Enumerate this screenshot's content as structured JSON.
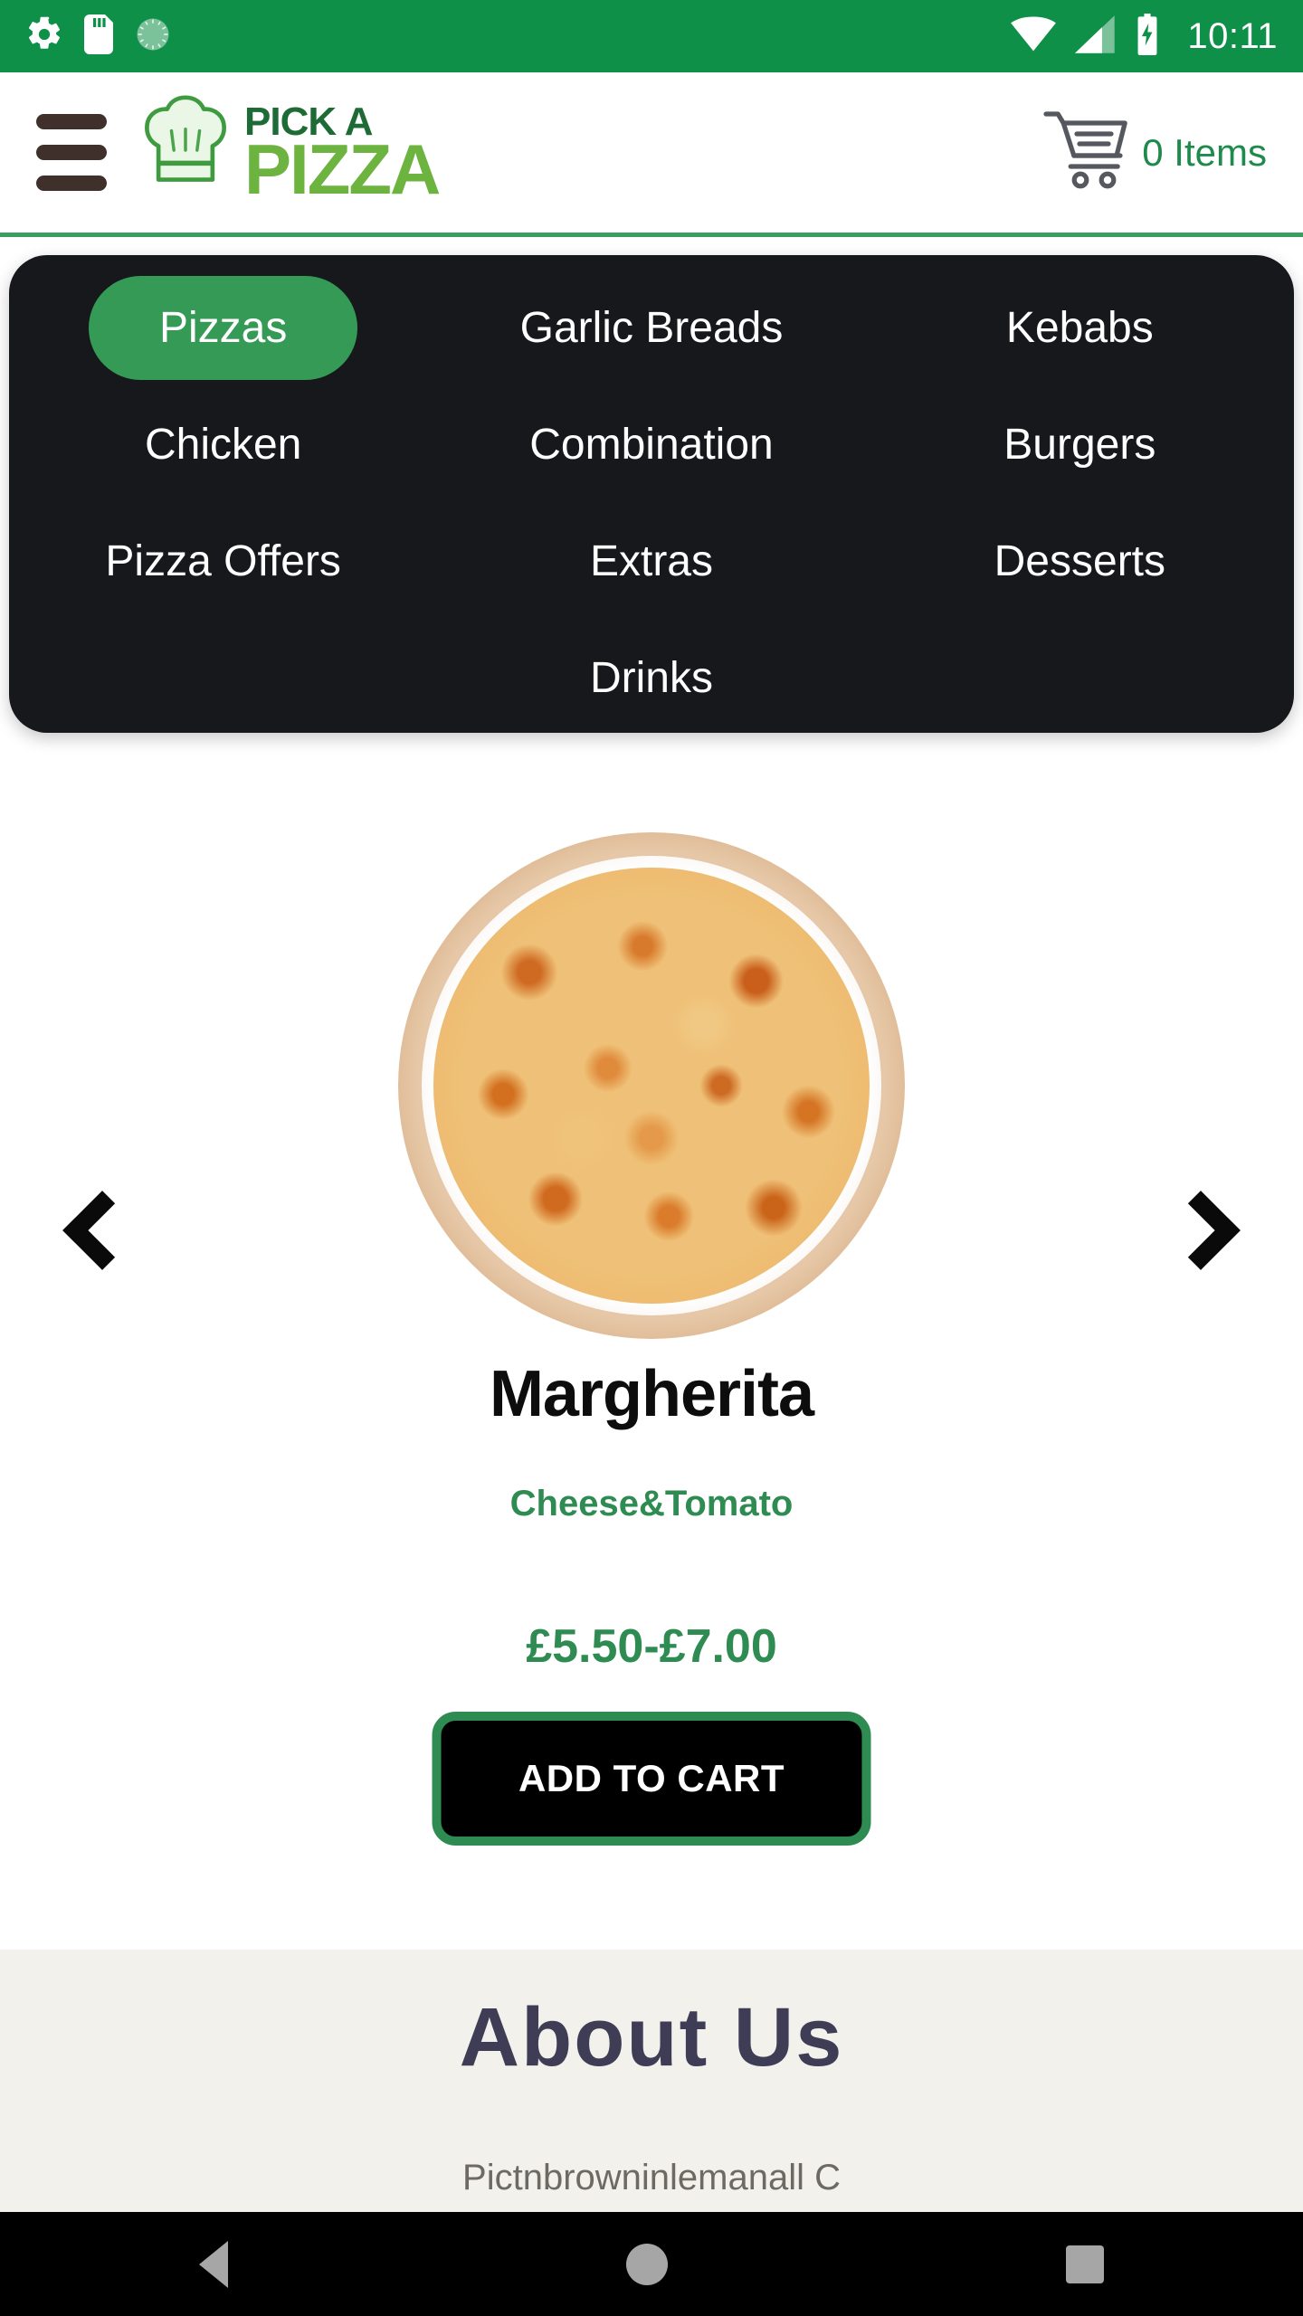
{
  "status_bar": {
    "time": "10:11",
    "left_icons": [
      "settings-gear-icon",
      "sd-card-icon",
      "circular-progress-icon"
    ],
    "right_icons": [
      "wifi-icon",
      "cellular-signal-icon",
      "battery-charging-icon"
    ],
    "background_color": "#0f9049"
  },
  "header": {
    "menu_icon": "hamburger-menu-icon",
    "logo_top": "PICK A",
    "logo_bottom": "PIZZA",
    "logo_icon": "chef-hat-icon",
    "cart_icon": "shopping-cart-icon",
    "cart_label": "0 Items",
    "accent_color": "#3a9e5e"
  },
  "categories": {
    "active": "Pizzas",
    "items": [
      {
        "label": "Pizzas",
        "active": true
      },
      {
        "label": "Garlic Breads",
        "active": false
      },
      {
        "label": "Kebabs",
        "active": false
      },
      {
        "label": "Chicken",
        "active": false
      },
      {
        "label": "Combination",
        "active": false
      },
      {
        "label": "Burgers",
        "active": false
      },
      {
        "label": "Pizza Offers",
        "active": false
      },
      {
        "label": "Extras",
        "active": false
      },
      {
        "label": "Desserts",
        "active": false
      },
      {
        "label": "Drinks",
        "active": false
      }
    ],
    "panel_color": "#17181c",
    "active_color": "#349a56"
  },
  "product": {
    "image_icon": "margherita-pizza-photo",
    "name": "Margherita",
    "description": "Cheese&Tomato",
    "price": "£5.50-£7.00",
    "add_to_cart_label": "ADD TO CART",
    "prev_icon": "chevron-left-icon",
    "next_icon": "chevron-right-icon",
    "price_color": "#2e8b52"
  },
  "about": {
    "title": "About Us",
    "body": "Pictnbrowninlemanall C",
    "background_color": "#f2f1ec",
    "title_color": "#3f3d56"
  },
  "navigation_bar": {
    "back_icon": "triangle-back-icon",
    "home_icon": "circle-home-icon",
    "recents_icon": "square-recents-icon"
  }
}
